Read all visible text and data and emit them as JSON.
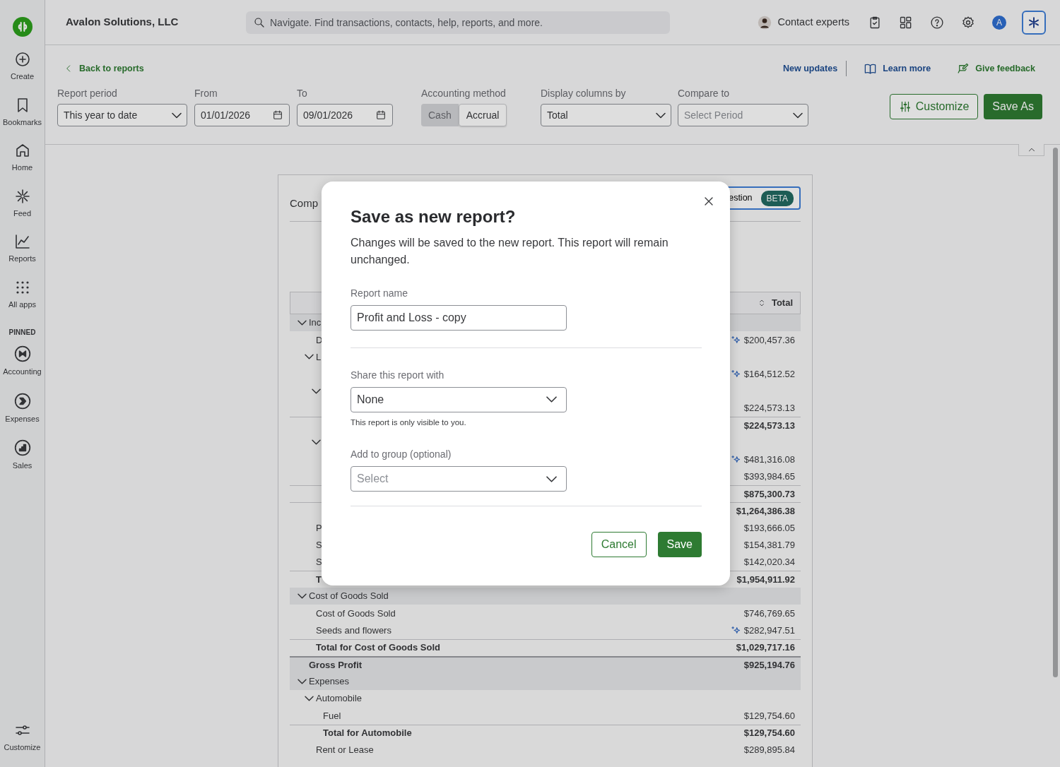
{
  "top_bar": {
    "company": "Avalon Solutions, LLC",
    "search": {
      "placeholder": "Navigate. Find transactions, contacts, help, reports, and more."
    },
    "contact_experts": "Contact experts",
    "avatar_initial": "A"
  },
  "sidebar": {
    "items": [
      {
        "label": "Create"
      },
      {
        "label": "Bookmarks"
      },
      {
        "label": "Home"
      },
      {
        "label": "Feed"
      },
      {
        "label": "Reports"
      },
      {
        "label": "All apps"
      }
    ],
    "pinned_heading": "PINNED",
    "pinned": [
      {
        "label": "Accounting"
      },
      {
        "label": "Expenses"
      },
      {
        "label": "Sales"
      }
    ],
    "footer_item": {
      "label": "Customize"
    }
  },
  "toolbar": {
    "back_link": "Back to reports",
    "links": [
      "New updates",
      "Learn more",
      "Give feedback"
    ],
    "report_period": {
      "label": "Report period",
      "value": "This year to date"
    },
    "from": {
      "label": "From",
      "value": "01/01/2026"
    },
    "to": {
      "label": "To",
      "value": "09/01/2026"
    },
    "accounting_method": {
      "label": "Accounting method",
      "options": [
        {
          "label": "Cash",
          "selected": false
        },
        {
          "label": "Accrual",
          "selected": true
        }
      ]
    },
    "display_columns": {
      "label": "Display columns by",
      "value": "Total"
    },
    "compare_to": {
      "label": "Compare to",
      "placeholder": "Select Period"
    },
    "buttons": [
      "Customize",
      "Save As"
    ]
  },
  "report": {
    "title_fragment": "Comp",
    "suggestion_fragment": "estion",
    "beta_badge": "BETA",
    "column_header": "Total",
    "rows": [
      {
        "kind": "section",
        "label": "Inc",
        "expanded": true,
        "children": [
          {
            "kind": "item",
            "label": "D",
            "value": "$200,457.36",
            "suggested": true
          },
          {
            "kind": "group",
            "label": "L",
            "expanded": true,
            "children": [
              {
                "kind": "item",
                "value": "$164,512.52",
                "suggested": true
              },
              {
                "kind": "group",
                "expanded": true,
                "children": [
                  {
                    "kind": "item",
                    "value": "$224,573.13"
                  },
                  {
                    "kind": "total",
                    "value": "$224,573.13"
                  }
                ]
              },
              {
                "kind": "group",
                "expanded": true,
                "children": [
                  {
                    "kind": "item",
                    "value": "$481,316.08",
                    "suggested": true
                  },
                  {
                    "kind": "item",
                    "value": "$393,984.65"
                  },
                  {
                    "kind": "total",
                    "value": "$875,300.73"
                  }
                ]
              },
              {
                "kind": "total",
                "value": "$1,264,386.38"
              }
            ]
          },
          {
            "kind": "item",
            "label": "P",
            "value": "$193,666.05"
          },
          {
            "kind": "item",
            "label": "S",
            "value": "$154,381.79"
          },
          {
            "kind": "item",
            "label": "S",
            "value": "$142,020.34"
          },
          {
            "kind": "total",
            "label": "T",
            "value": "$1,954,911.92"
          }
        ]
      },
      {
        "kind": "section",
        "label": "Cost of Goods Sold",
        "expanded": true,
        "children": [
          {
            "kind": "item",
            "label": "Cost of Goods Sold",
            "value": "$746,769.65"
          },
          {
            "kind": "item",
            "label": "Seeds and flowers",
            "value": "$282,947.51",
            "suggested": true
          },
          {
            "kind": "total",
            "label": "Total for Cost of Goods Sold",
            "value": "$1,029,717.16"
          }
        ]
      },
      {
        "kind": "summary",
        "label": "Gross Profit",
        "value": "$925,194.76"
      },
      {
        "kind": "section",
        "label": "Expenses",
        "expanded": true,
        "children": [
          {
            "kind": "group",
            "label": "Automobile",
            "expanded": true,
            "children": [
              {
                "kind": "item",
                "label": "Fuel",
                "value": "$129,754.60"
              },
              {
                "kind": "total",
                "label": "Total for Automobile",
                "value": "$129,754.60"
              }
            ]
          },
          {
            "kind": "item",
            "label": "Rent or Lease",
            "value": "$289,895.84"
          }
        ]
      }
    ]
  },
  "dialog": {
    "title": "Save as new report?",
    "description": "Changes will be saved to the new report. This report will remain unchanged.",
    "report_name": {
      "label": "Report name",
      "value": "Profit and Loss - copy"
    },
    "share_with": {
      "label": "Share this report with",
      "value": "None",
      "help": "This report is only visible to you."
    },
    "group": {
      "label": "Add to group (optional)",
      "placeholder": "Select"
    },
    "buttons": [
      "Cancel",
      "Save"
    ]
  }
}
